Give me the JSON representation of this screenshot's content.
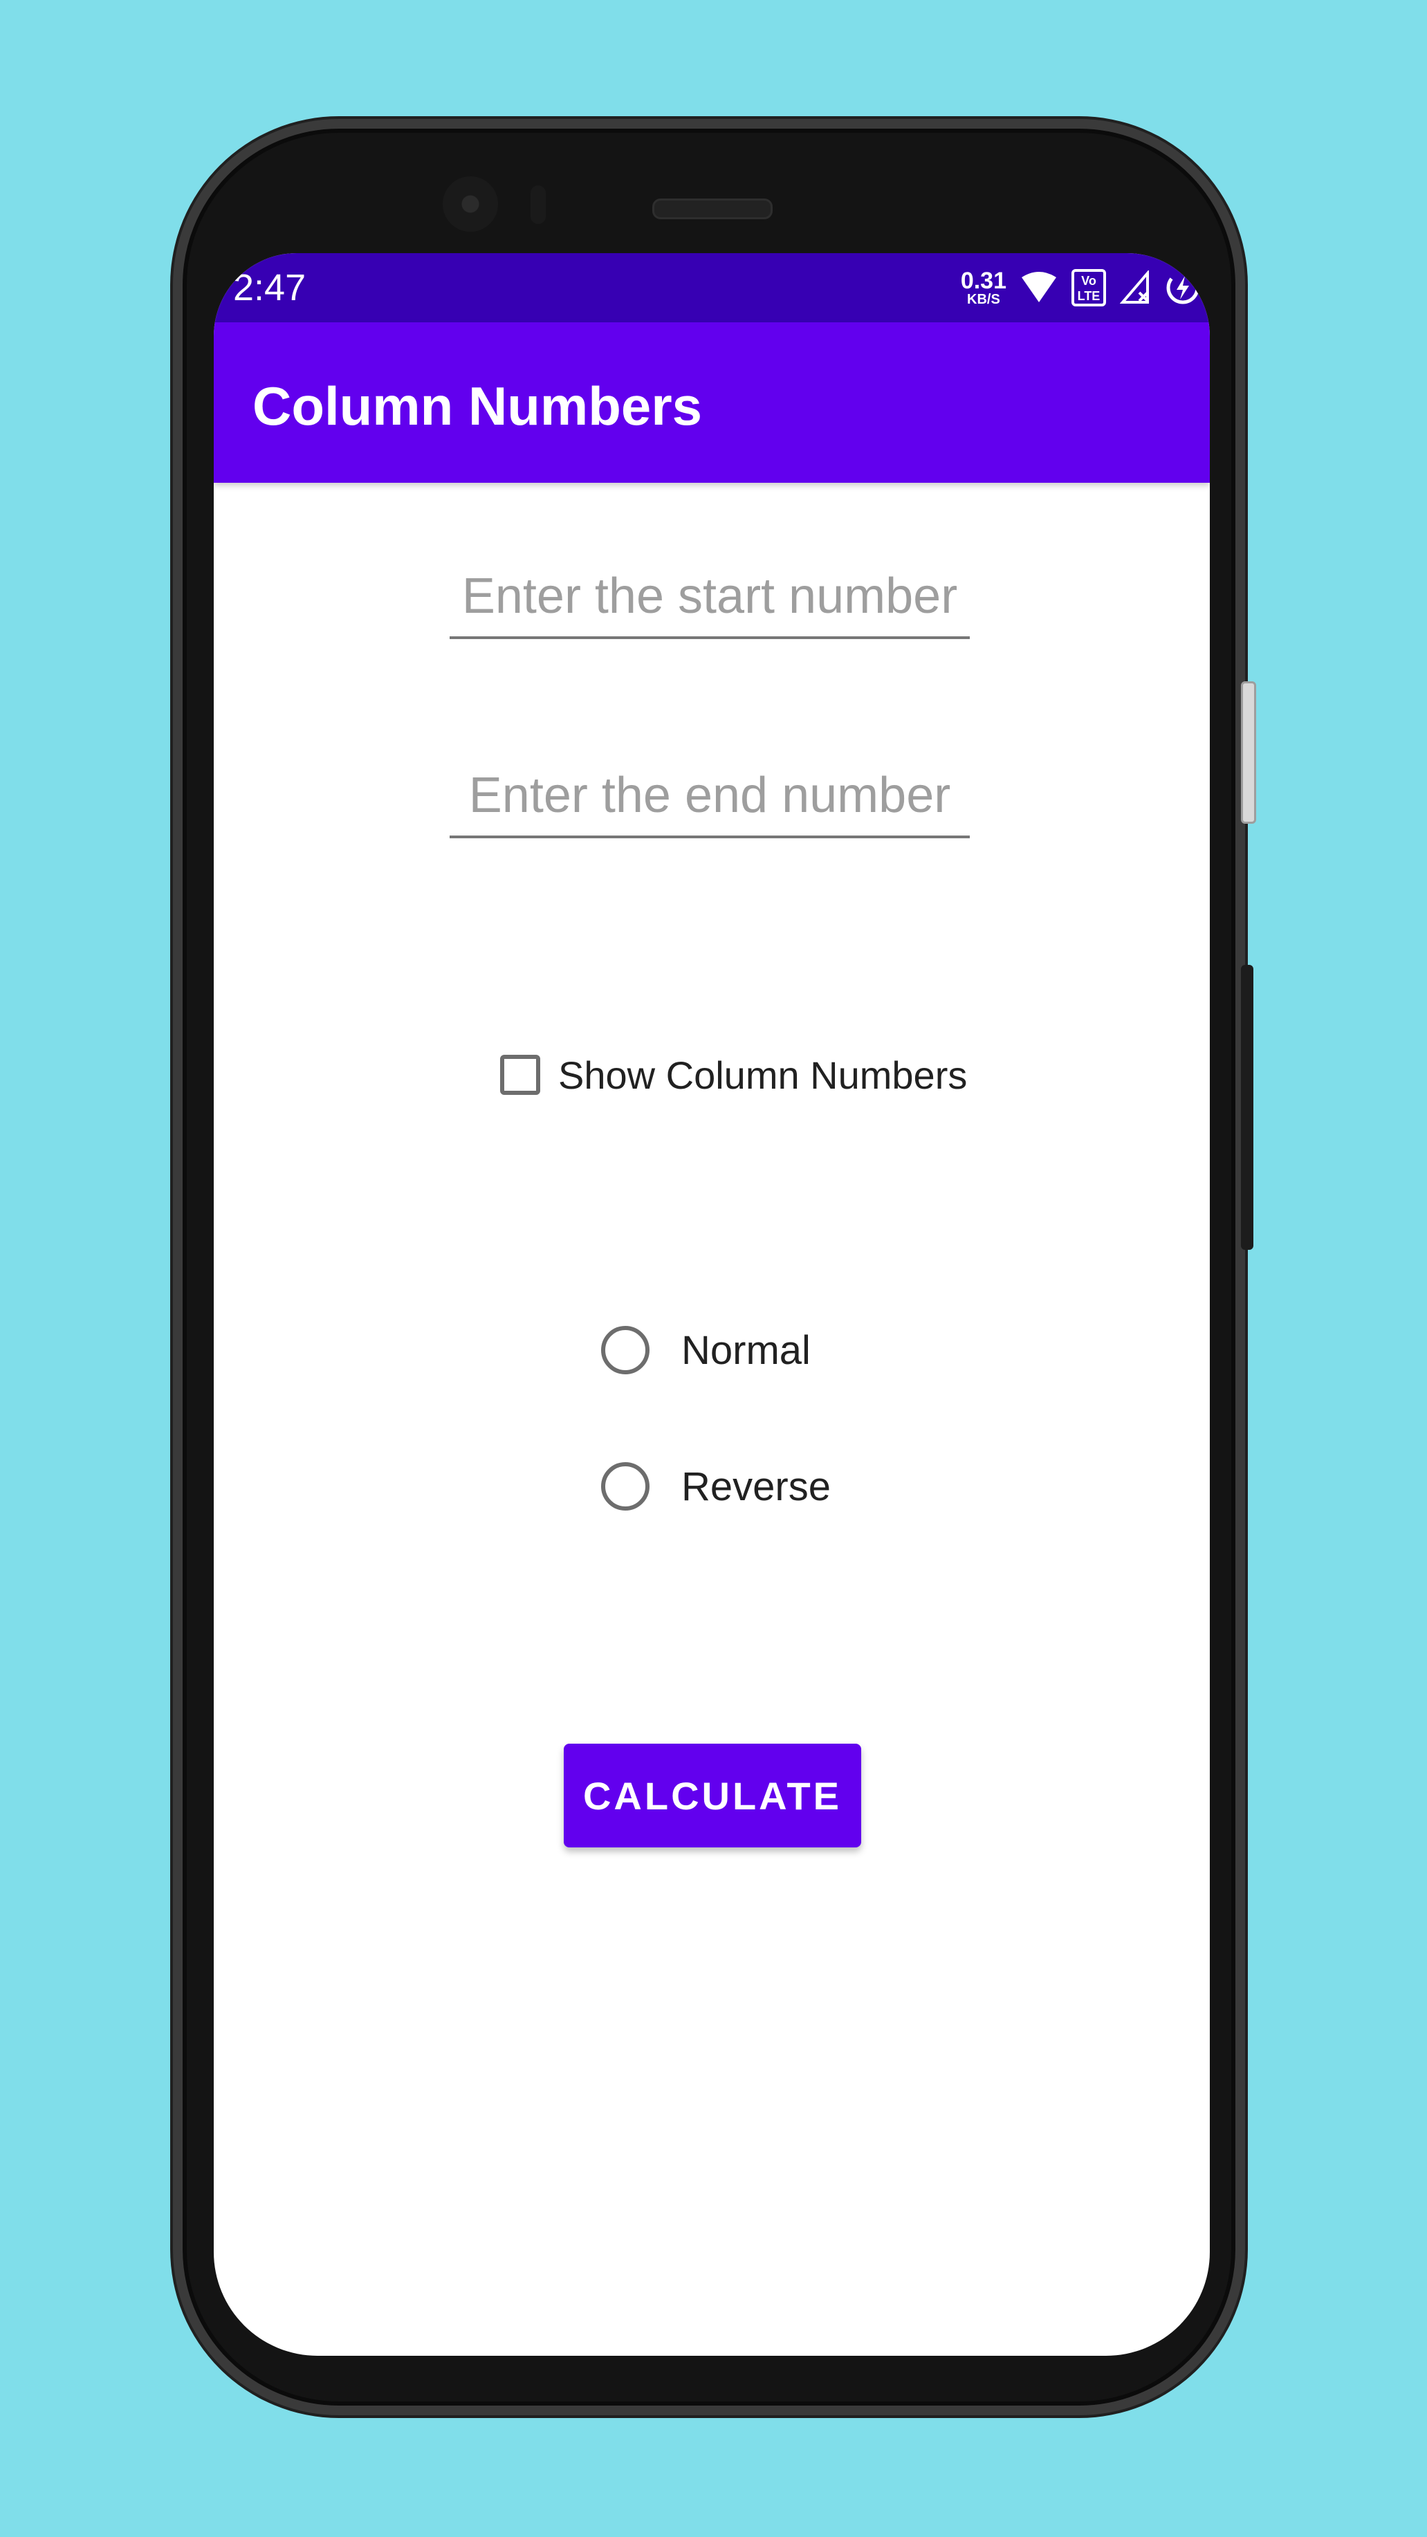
{
  "status_bar": {
    "time": "2:47",
    "net_speed_value": "0.31",
    "net_speed_unit": "KB/S",
    "icons": [
      "wifi-icon",
      "volte-icon",
      "signal-icon",
      "battery-charging-icon"
    ],
    "volte_top": "Vo",
    "volte_bottom": "LTE"
  },
  "app_bar": {
    "title": "Column Numbers"
  },
  "form": {
    "start_input": {
      "value": "",
      "placeholder": "Enter the start number"
    },
    "end_input": {
      "value": "",
      "placeholder": "Enter the end number"
    },
    "checkbox": {
      "label": "Show Column Numbers",
      "checked": false
    },
    "radio_options": [
      {
        "label": "Normal",
        "selected": false
      },
      {
        "label": "Reverse",
        "selected": false
      }
    ],
    "calculate_label": "CALCULATE"
  },
  "colors": {
    "background": "#80deea",
    "status_bar": "#3700b3",
    "primary": "#6200ee"
  }
}
